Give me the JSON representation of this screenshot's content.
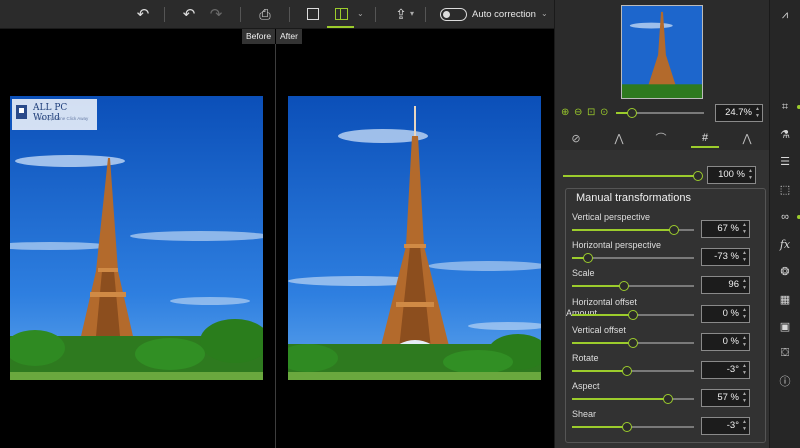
{
  "toolbar": {
    "buttons": [
      {
        "name": "histogram-icon",
        "glyph": "⩘",
        "disabled": false
      },
      {
        "name": "undo-icon",
        "glyph": "↶",
        "disabled": false
      },
      {
        "name": "redo-icon",
        "glyph": "↷",
        "disabled": true
      },
      {
        "name": "print-icon",
        "glyph": "⎙",
        "disabled": false
      },
      {
        "name": "single-view-icon",
        "glyph": "▢",
        "disabled": false
      },
      {
        "name": "split-view-icon",
        "glyph": "◫",
        "disabled": false
      },
      {
        "name": "share-icon",
        "glyph": "⇪",
        "disabled": false
      }
    ],
    "auto_correction_label": "Auto correction",
    "auto_correction_on": false,
    "accent_color": "#9ccc2c"
  },
  "preview": {
    "before_label": "Before",
    "after_label": "After",
    "watermark": {
      "title": "ALL PC World",
      "subtitle": "Free Apps One Click Away"
    }
  },
  "navigator": {
    "zoom_value": "24.7%",
    "zoom_icons": [
      "zoom-in-icon",
      "zoom-out-icon",
      "zoom-fit-icon",
      "zoom-100-icon"
    ]
  },
  "tool_tabs": [
    {
      "name": "lens-tab-icon",
      "glyph": "⊘"
    },
    {
      "name": "perspective-tab-icon",
      "glyph": "⋀"
    },
    {
      "name": "horizon-tab-icon",
      "glyph": "⌒"
    },
    {
      "name": "grid-tab-icon",
      "glyph": "#",
      "active": true
    },
    {
      "name": "vertical-lines-tab-icon",
      "glyph": "⋀"
    }
  ],
  "amount": {
    "label": "Amount",
    "value": "100 %",
    "fraction": 1.0
  },
  "manual_transformations": {
    "title": "Manual transformations",
    "rows": [
      {
        "label": "Vertical perspective",
        "value": "67 %",
        "fraction": 0.835
      },
      {
        "label": "Horizontal perspective",
        "value": "-73 %",
        "fraction": 0.135
      },
      {
        "label": "Scale",
        "value": "96",
        "fraction": 0.43
      },
      {
        "label": "Horizontal offset",
        "value": "0 %",
        "fraction": 0.5
      },
      {
        "label": "Vertical offset",
        "value": "0 %",
        "fraction": 0.5
      },
      {
        "label": "Rotate",
        "value": "-3°",
        "fraction": 0.45
      },
      {
        "label": "Aspect",
        "value": "57 %",
        "fraction": 0.785
      },
      {
        "label": "Shear",
        "value": "-3°",
        "fraction": 0.45
      }
    ]
  },
  "side_icons": [
    {
      "name": "histogram-panel-icon",
      "glyph": "⩘",
      "dot": false
    },
    {
      "name": "crop-icon",
      "glyph": "⌗",
      "dot": true
    },
    {
      "name": "flask-icon",
      "glyph": "⚗",
      "dot": false
    },
    {
      "name": "adjustments-icon",
      "glyph": "☰",
      "dot": false
    },
    {
      "name": "selection-icon",
      "glyph": "⬚",
      "dot": false
    },
    {
      "name": "glasses-icon",
      "glyph": "∞",
      "dot": true
    },
    {
      "name": "effects-fx-icon",
      "glyph": "fx",
      "dot": false
    },
    {
      "name": "color-circles-icon",
      "glyph": "❂",
      "dot": false
    },
    {
      "name": "texture-icon",
      "glyph": "▦",
      "dot": false
    },
    {
      "name": "frame-icon",
      "glyph": "▣",
      "dot": false
    },
    {
      "name": "paint-bucket-icon",
      "glyph": "⛋",
      "dot": false
    },
    {
      "name": "info-icon",
      "glyph": "ⓘ",
      "dot": false
    }
  ]
}
